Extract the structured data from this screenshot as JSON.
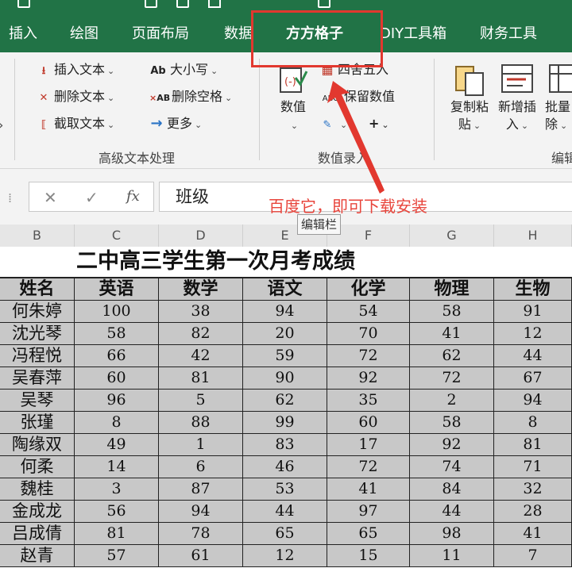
{
  "tabs": [
    {
      "label": "插入",
      "active": false
    },
    {
      "label": "绘图",
      "active": false
    },
    {
      "label": "页面布局",
      "active": false
    },
    {
      "label": "数据",
      "active": false
    },
    {
      "label": "方方格子",
      "active": true
    },
    {
      "label": "DIY工具箱",
      "active": false
    },
    {
      "label": "财务工具",
      "active": false
    }
  ],
  "ribbon": {
    "text_group": {
      "label": "高级文本处理",
      "insert_text": "插入文本",
      "delete_text": "删除文本",
      "extract_text": "截取文本",
      "case": "大小写",
      "delete_spaces": "删除空格",
      "more": "更多",
      "case_icon": "Ab",
      "spaces_icon": "AB"
    },
    "value_group": {
      "label": "数值录入",
      "value_button": "数值",
      "round": "四舍五入",
      "keep_values": "保留数值",
      "keep_icon": "ABC"
    },
    "edit_group": {
      "copy_paste": [
        "复制粘",
        "贴"
      ],
      "add_insert": [
        "新增插",
        "入"
      ],
      "batch_delete": [
        "批量",
        "除"
      ],
      "label": "编辑"
    }
  },
  "annotation": "百度它，即可下载安装",
  "tooltip": "编辑栏",
  "formula_bar": {
    "value": "班级",
    "fx": "fx"
  },
  "columns": [
    "B",
    "C",
    "D",
    "E",
    "F",
    "G",
    "H"
  ],
  "sheet": {
    "title": "二中高三学生第一次月考成绩",
    "headers": [
      "姓名",
      "英语",
      "数学",
      "语文",
      "化学",
      "物理",
      "生物"
    ],
    "rows": [
      [
        "何朱婷",
        "100",
        "38",
        "94",
        "54",
        "58",
        "91"
      ],
      [
        "沈光琴",
        "58",
        "82",
        "20",
        "70",
        "41",
        "12"
      ],
      [
        "冯程悦",
        "66",
        "42",
        "59",
        "72",
        "62",
        "44"
      ],
      [
        "吴春萍",
        "60",
        "81",
        "90",
        "92",
        "72",
        "67"
      ],
      [
        "吴琴",
        "96",
        "5",
        "62",
        "35",
        "2",
        "94"
      ],
      [
        "张瑾",
        "8",
        "88",
        "99",
        "60",
        "58",
        "8"
      ],
      [
        "陶缘双",
        "49",
        "1",
        "83",
        "17",
        "92",
        "81"
      ],
      [
        "何柔",
        "14",
        "6",
        "46",
        "72",
        "74",
        "71"
      ],
      [
        "魏桂",
        "3",
        "87",
        "53",
        "41",
        "84",
        "32"
      ],
      [
        "金成龙",
        "56",
        "94",
        "44",
        "97",
        "44",
        "28"
      ],
      [
        "吕成倩",
        "81",
        "78",
        "65",
        "65",
        "98",
        "41"
      ],
      [
        "赵青",
        "57",
        "61",
        "12",
        "15",
        "11",
        "7"
      ]
    ]
  },
  "colors": {
    "accent": "#217346",
    "highlight": "#e2382f",
    "annotation": "#e8453c",
    "cell_fill": "#c8c8c8"
  },
  "icons": {
    "insert_text": "insert-text-icon",
    "delete_text": "delete-text-icon",
    "extract_text": "extract-text-icon",
    "case": "change-case-icon",
    "delete_spaces": "delete-spaces-icon",
    "more": "arrow-right-icon",
    "value": "value-icon",
    "round": "round-icon",
    "keep_values": "keep-values-icon",
    "copy_paste": "copy-paste-icon",
    "add_insert": "add-insert-icon",
    "batch_delete": "batch-delete-icon",
    "cancel": "cancel-icon",
    "confirm": "check-icon"
  }
}
